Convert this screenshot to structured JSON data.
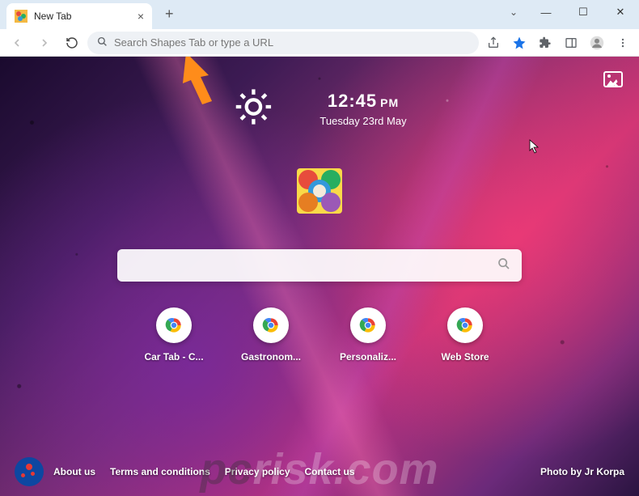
{
  "window": {
    "tab_title": "New Tab"
  },
  "toolbar": {
    "placeholder": "Search Shapes Tab or type a URL"
  },
  "clock": {
    "time": "12:45",
    "ampm": "PM",
    "date": "Tuesday 23rd May"
  },
  "search": {
    "placeholder": ""
  },
  "shortcuts": [
    {
      "label": "Car Tab - C..."
    },
    {
      "label": "Gastronom..."
    },
    {
      "label": "Personaliz..."
    },
    {
      "label": "Web Store"
    }
  ],
  "footer": {
    "links": [
      "About us",
      "Terms and conditions",
      "Privacy policy",
      "Contact us"
    ],
    "credit": "Photo by Jr Korpa"
  },
  "watermark": "pcrisk.com"
}
